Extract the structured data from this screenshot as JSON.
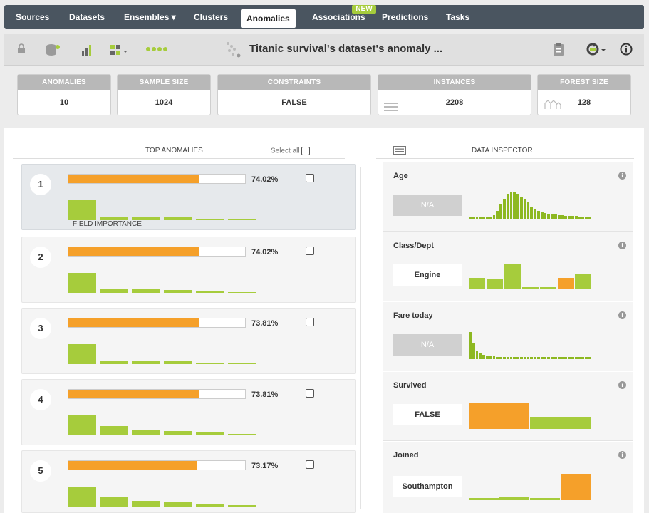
{
  "nav": {
    "items": [
      {
        "label": "Sources"
      },
      {
        "label": "Datasets"
      },
      {
        "label": "Ensembles ▾"
      },
      {
        "label": "Clusters"
      },
      {
        "label": "Anomalies"
      },
      {
        "label": "Associations"
      },
      {
        "label": "Predictions"
      },
      {
        "label": "Tasks"
      }
    ],
    "new_badge": "NEW"
  },
  "toolbar": {
    "title": "Titanic survival's dataset's anomaly ..."
  },
  "summary": [
    {
      "header": "ANOMALIES",
      "value": "10"
    },
    {
      "header": "SAMPLE SIZE",
      "value": "1024"
    },
    {
      "header": "CONSTRAINTS",
      "value": "FALSE"
    },
    {
      "header": "INSTANCES",
      "value": "2208"
    },
    {
      "header": "FOREST SIZE",
      "value": "128"
    }
  ],
  "top_anomalies": {
    "title": "TOP ANOMALIES",
    "select_all": "Select all",
    "field_importance_label": "FIELD IMPORTANCE",
    "items": [
      {
        "rank": "1",
        "score_label": "74.02%",
        "score": 74.02
      },
      {
        "rank": "2",
        "score_label": "74.02%",
        "score": 74.02
      },
      {
        "rank": "3",
        "score_label": "73.81%",
        "score": 73.81
      },
      {
        "rank": "4",
        "score_label": "73.81%",
        "score": 73.81
      },
      {
        "rank": "5",
        "score_label": "73.17%",
        "score": 73.17
      }
    ]
  },
  "inspector": {
    "title": "DATA INSPECTOR",
    "fields": [
      {
        "name": "Age",
        "value": "N/A"
      },
      {
        "name": "Class/Dept",
        "value": "Engine"
      },
      {
        "name": "Fare today",
        "value": "N/A"
      },
      {
        "name": "Survived",
        "value": "FALSE"
      },
      {
        "name": "Joined",
        "value": "Southampton"
      }
    ]
  },
  "colors": {
    "nav_bg": "#4a5560",
    "score_bar": "#f5a02a",
    "field_bar": "#a6cc3c",
    "histogram_green": "#8db821",
    "histogram_highlight": "#f5a02a"
  }
}
